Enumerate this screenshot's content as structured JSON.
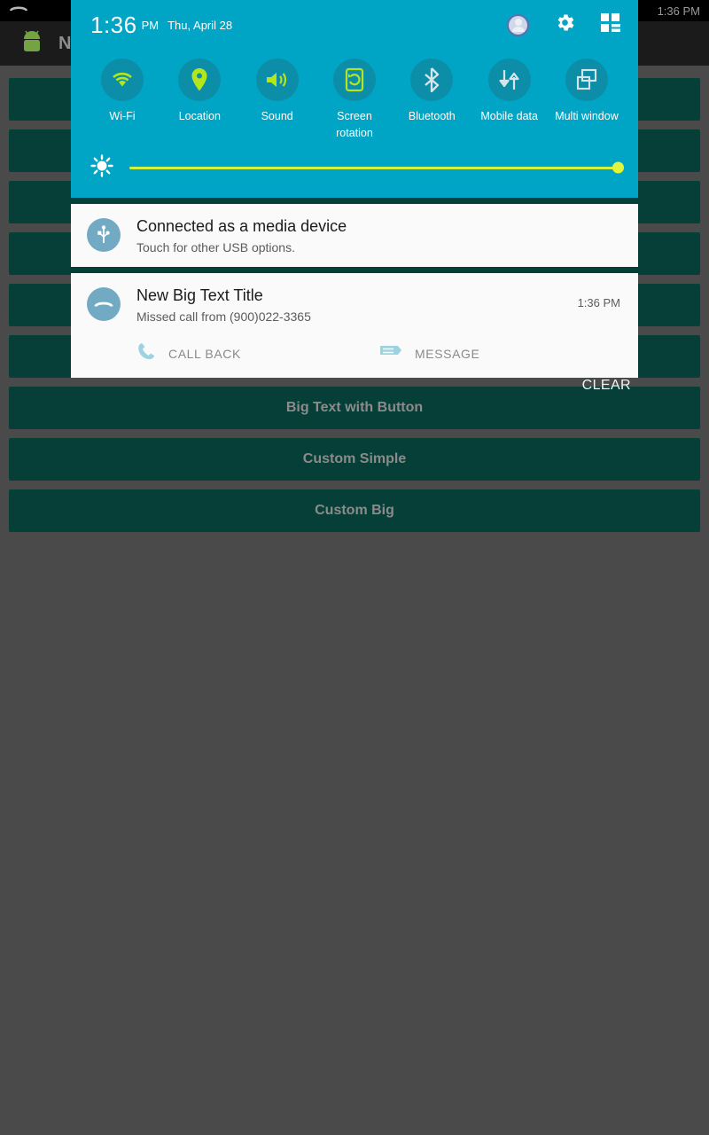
{
  "status_bar": {
    "missed_call_icon": "missed-call-icon",
    "clock": "1:36 PM"
  },
  "background_app": {
    "title": "N",
    "app_icon": "android-robot-icon",
    "buttons": [
      {
        "label": ""
      },
      {
        "label": ""
      },
      {
        "label": ""
      },
      {
        "label": ""
      },
      {
        "label": ""
      },
      {
        "label": ""
      },
      {
        "label": "Big Text with Button"
      },
      {
        "label": "Custom Simple"
      },
      {
        "label": "Custom Big"
      }
    ]
  },
  "quick_settings": {
    "time": "1:36",
    "ampm": "PM",
    "date": "Thu, April 28",
    "avatar": "user-avatar",
    "settings_icon": "gear-icon",
    "expand_icon": "quick-settings-grid-icon",
    "accent_color": "#00a4c4",
    "active_icon_color": "#b5e61d",
    "inactive_icon_color": "#d8e5e8",
    "toggles": [
      {
        "label": "Wi-Fi",
        "icon": "wifi-icon",
        "active": true
      },
      {
        "label": "Location",
        "icon": "location-pin-icon",
        "active": true
      },
      {
        "label": "Sound",
        "icon": "sound-speaker-icon",
        "active": true
      },
      {
        "label": "Screen rotation",
        "icon": "screen-rotation-icon",
        "active": true
      },
      {
        "label": "Bluetooth",
        "icon": "bluetooth-icon",
        "active": false
      },
      {
        "label": "Mobile data",
        "icon": "mobile-data-icon",
        "active": false
      },
      {
        "label": "Multi window",
        "icon": "multi-window-icon",
        "active": false
      }
    ],
    "brightness": {
      "icon": "brightness-sun-icon",
      "value": 100,
      "track_color": "#d7f23d"
    }
  },
  "notifications": [
    {
      "icon": "usb-icon",
      "title": "Connected as a media device",
      "subtitle": "Touch for other USB options.",
      "time": "",
      "actions": []
    },
    {
      "icon": "missed-call-icon",
      "title": "New Big Text Title",
      "subtitle": "Missed call from (900)022-3365",
      "time": "1:36 PM",
      "actions": [
        {
          "label": "CALL BACK",
          "icon": "phone-icon"
        },
        {
          "label": "MESSAGE",
          "icon": "message-icon"
        }
      ]
    }
  ],
  "clear_button": {
    "label": "CLEAR"
  }
}
